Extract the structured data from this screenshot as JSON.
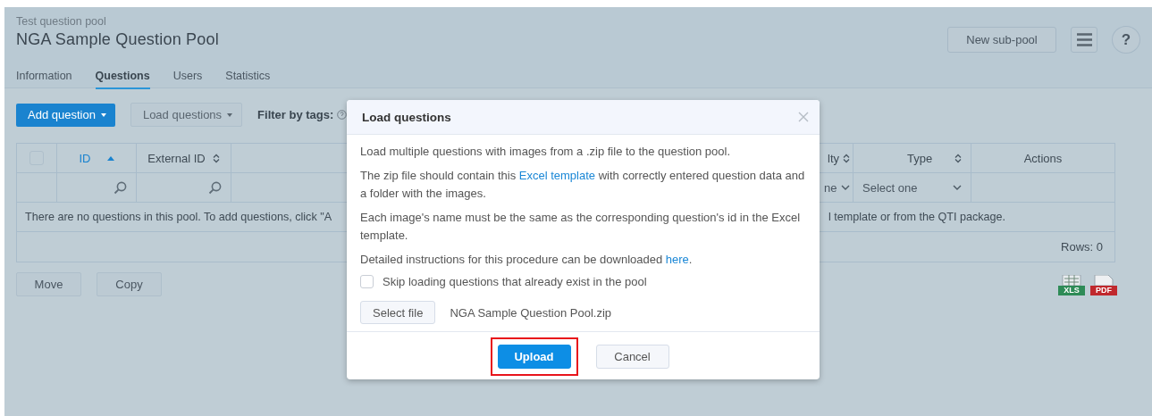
{
  "header": {
    "breadcrumb": "Test question pool",
    "title": "NGA Sample Question Pool",
    "new_subpool_button": "New sub-pool",
    "help_button": "?"
  },
  "tabs": [
    {
      "label": "Information",
      "selected": false
    },
    {
      "label": "Questions",
      "selected": true
    },
    {
      "label": "Users",
      "selected": false
    },
    {
      "label": "Statistics",
      "selected": false
    }
  ],
  "toolbar": {
    "add_button": "Add question",
    "load_button": "Load questions",
    "filter_label": "Filter by tags:"
  },
  "table": {
    "columns": [
      {
        "kind": "checkbox",
        "checked": false
      },
      {
        "kind": "sortable",
        "label": "ID",
        "sorted": true
      },
      {
        "kind": "sortable",
        "label": "External ID",
        "sorted": false
      },
      {
        "kind": "covered"
      },
      {
        "kind": "sortable",
        "label": "lty",
        "sorted": false
      },
      {
        "kind": "sortable",
        "label": "Type",
        "sorted": false
      },
      {
        "kind": "plain",
        "label": "Actions"
      }
    ],
    "filters": [
      {
        "kind": "none"
      },
      {
        "kind": "search"
      },
      {
        "kind": "search"
      },
      {
        "kind": "none"
      },
      {
        "kind": "select",
        "value": "ne"
      },
      {
        "kind": "select",
        "value": "Select one"
      },
      {
        "kind": "none"
      }
    ],
    "message_parts": [
      "There are no questions in this pool. To add questions, click \"A",
      "l template or from the QTI package."
    ],
    "rows_count": "Rows: 0"
  },
  "bottom_buttons": [
    "Move",
    "Copy"
  ],
  "export_icons": [
    "XLS",
    "PDF"
  ],
  "dialog": {
    "title": "Load questions",
    "paragraphs": [
      [
        {
          "kind": "text",
          "text": "Load multiple questions with images from a .zip file to the question pool."
        }
      ],
      [
        {
          "kind": "text",
          "text": "The zip file should contain this "
        },
        {
          "kind": "link",
          "text": "Excel template"
        },
        {
          "kind": "text",
          "text": " with correctly entered question data and a folder with the images."
        }
      ],
      [
        {
          "kind": "text",
          "text": "Each image's name must be the same as the corresponding question's id in the Excel template."
        }
      ],
      [
        {
          "kind": "text",
          "text": "Detailed instructions for this procedure can be downloaded "
        },
        {
          "kind": "link",
          "text": "here"
        },
        {
          "kind": "text",
          "text": "."
        }
      ]
    ],
    "skip_checkbox": {
      "label": "Skip loading questions that already exist in the pool",
      "checked": false
    },
    "select_file_button": "Select file",
    "file_name": "NGA Sample Question Pool.zip",
    "buttons": [
      {
        "label": "Upload",
        "kind": "primary",
        "highlighted": true
      },
      {
        "label": "Cancel",
        "kind": "secondary",
        "highlighted": false
      }
    ]
  }
}
